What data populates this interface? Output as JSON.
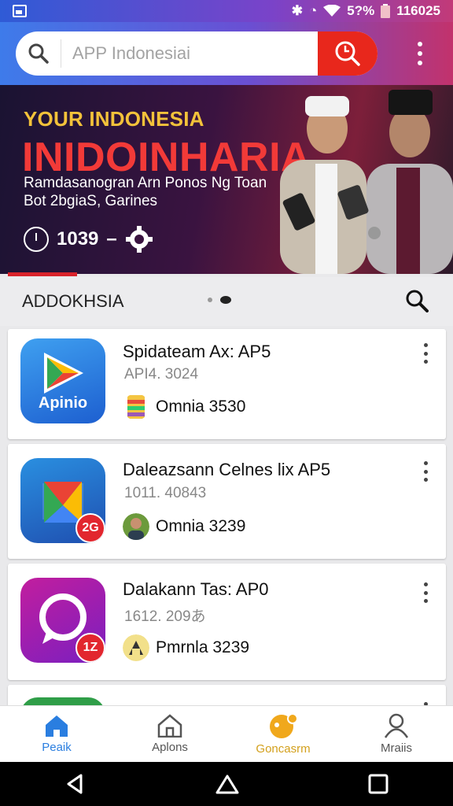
{
  "status_bar": {
    "battery": "5?%",
    "time": "116025"
  },
  "search": {
    "placeholder": "APP Indonesiai"
  },
  "banner": {
    "kicker": "YOUR INDONESIA",
    "title": "INIDOINHARIA",
    "subtitle_line1": "Ramdasanogran Arn Ponos Ng Toan",
    "subtitle_line2": "Bot 2bgiaS, Garines",
    "stat_value": "1039",
    "stat_separator": "–"
  },
  "section": {
    "title": "ADDOKHSIA"
  },
  "apps": [
    {
      "name": "Spidateam Ax: AP5",
      "version": "API4. 3024",
      "developer": "Omnia 3530",
      "icon_label": "Apinio",
      "icon": "play-store-icon"
    },
    {
      "name": "Daleazsann Celnes lix AP5",
      "version": "1011. 40843",
      "developer": "Omnia 3239",
      "badge": "2G",
      "icon": "maps-icon"
    },
    {
      "name": "Dalakann Tas: AP0",
      "version": "1612. 209あ",
      "developer": "Pmrnla 3239",
      "badge": "1Z",
      "icon": "chat-bubble-icon"
    }
  ],
  "bottom_nav": {
    "items": [
      {
        "label": "Peaik",
        "icon": "home-icon"
      },
      {
        "label": "Aplons",
        "icon": "apps-icon"
      },
      {
        "label": "Goncasrm",
        "icon": "games-icon"
      },
      {
        "label": "Mraiis",
        "icon": "profile-icon"
      }
    ]
  },
  "colors": {
    "accent_red": "#e8271c",
    "nav_active": "#2a7ee0",
    "nav_gold": "#d3a01c",
    "banner_title": "#f23a38",
    "banner_kicker": "#f3c23a"
  }
}
